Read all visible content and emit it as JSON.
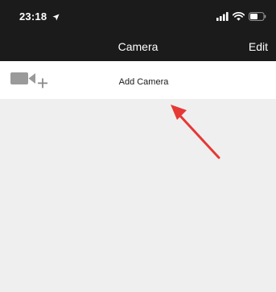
{
  "status_bar": {
    "time": "23:18",
    "icons": [
      "location-arrow-icon",
      "cellular-signal-icon",
      "wifi-icon",
      "battery-icon"
    ]
  },
  "nav": {
    "title": "Camera",
    "edit_label": "Edit"
  },
  "add_row": {
    "label": "Add Camera",
    "icon": "camera-plus-icon"
  },
  "annotation": {
    "icon": "red-arrow-pointer",
    "color": "#e53935"
  },
  "colors": {
    "bar_background": "#1b1b1b",
    "list_background": "#efefef",
    "icon_gray": "#9a9a9a"
  }
}
